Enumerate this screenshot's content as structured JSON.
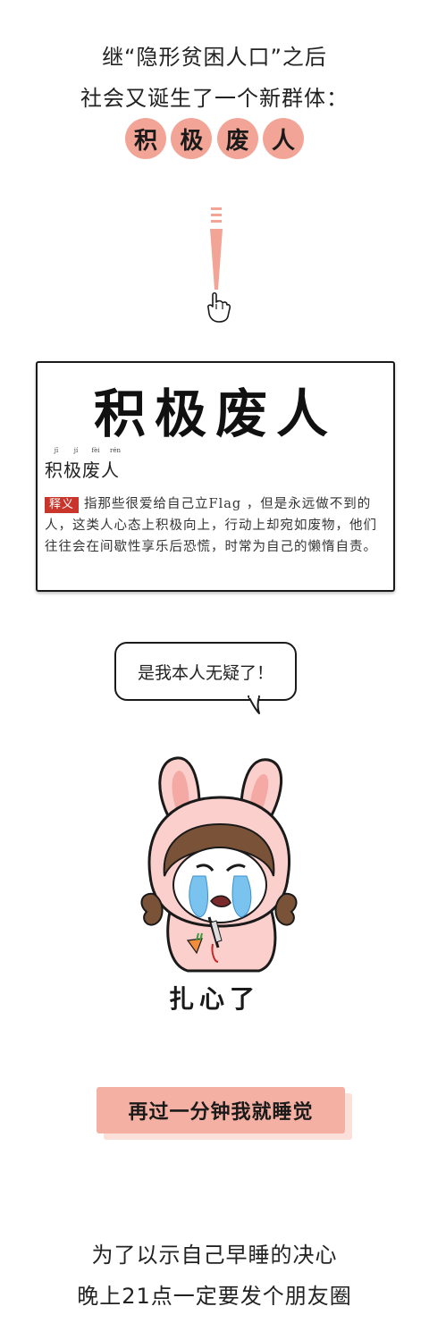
{
  "intro": {
    "line1": "继“隐形贫困人口”之后",
    "line2": "社会又诞生了一个新群体：",
    "circle_chars": [
      "积",
      "极",
      "废",
      "人"
    ]
  },
  "card": {
    "title": "积极废人",
    "pinyin": [
      "jī",
      "jí",
      "fèi",
      "rén"
    ],
    "term": "积极废人",
    "tag": "释义",
    "definition": "指那些很爱给自己立Flag ，但是永远做不到的人，这类人心态上积极向上，行动上却宛如废物，他们往往会在间歇性享乐后恐慌，时常为自己的懒惰自责。"
  },
  "bubble": {
    "text": "是我本人无疑了！"
  },
  "meme": {
    "caption": "扎心了"
  },
  "label": {
    "text": "再过一分钟我就睡觉"
  },
  "outro": {
    "line1": "为了以示自己早睡的决心",
    "line2": "晚上21点一定要发个朋友圈"
  },
  "colors": {
    "accent_pink": "#f2a596",
    "label_pink": "#f4b1a3",
    "tag_red": "#c9352b"
  }
}
